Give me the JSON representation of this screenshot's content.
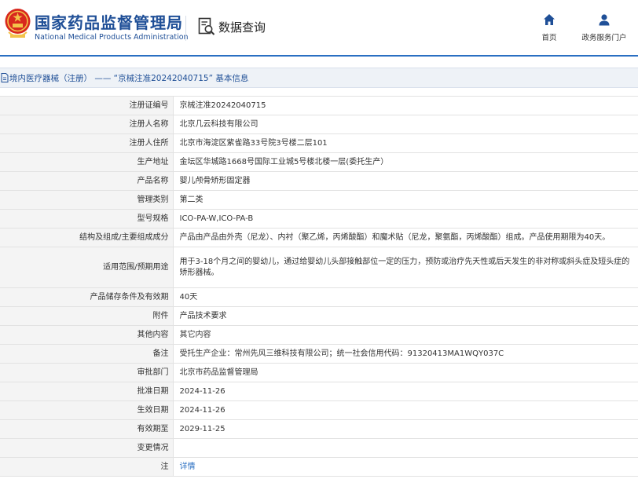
{
  "header": {
    "brand_cn": "国家药品监督管理局",
    "brand_en": "National Medical Products Administration",
    "query_label": "数据查询",
    "nav": {
      "home": "首页",
      "portal": "政务服务门户"
    }
  },
  "title": "境内医疗器械（注册） —— “京械注准20242040715” 基本信息",
  "colors": {
    "brand_blue": "#1f4f97",
    "link_blue": "#2a6fc2",
    "label_bg": "#f4f4f4"
  },
  "rows": [
    {
      "label": "注册证编号",
      "value": "京械注准20242040715"
    },
    {
      "label": "注册人名称",
      "value": "北京几云科技有限公司"
    },
    {
      "label": "注册人住所",
      "value": "北京市海淀区紫雀路33号院3号楼二层101"
    },
    {
      "label": "生产地址",
      "value": "金坛区华城路1668号国际工业城5号楼北楼一层(委托生产）"
    },
    {
      "label": "产品名称",
      "value": "婴儿颅骨矫形固定器"
    },
    {
      "label": "管理类别",
      "value": "第二类"
    },
    {
      "label": "型号规格",
      "value": "ICO-PA-W,ICO-PA-B"
    },
    {
      "label": "结构及组成/主要组成成分",
      "value": "产品由产品由外壳（尼龙）、内衬（聚乙烯，丙烯酸酯）和魔术贴（尼龙，聚氨酯，丙烯酸酯）组成。产品使用期限为40天。"
    },
    {
      "label": "适用范围/预期用途",
      "value": "用于3-18个月之间的婴幼儿，通过给婴幼儿头部接触部位一定的压力，预防或治疗先天性或后天发生的非对称或斜头症及短头症的矫形器械。"
    },
    {
      "label": "产品储存条件及有效期",
      "value": "40天"
    },
    {
      "label": "附件",
      "value": "产品技术要求"
    },
    {
      "label": "其他内容",
      "value": "其它内容"
    },
    {
      "label": "备注",
      "value": "受托生产企业：常州先风三维科技有限公司；统一社会信用代码：91320413MA1WQY037C"
    },
    {
      "label": "审批部门",
      "value": "北京市药品监督管理局"
    },
    {
      "label": "批准日期",
      "value": "2024-11-26"
    },
    {
      "label": "生效日期",
      "value": "2024-11-26"
    },
    {
      "label": "有效期至",
      "value": "2029-11-25"
    },
    {
      "label": "变更情况",
      "value": ""
    },
    {
      "label": "注",
      "value": "详情",
      "link": true
    }
  ]
}
